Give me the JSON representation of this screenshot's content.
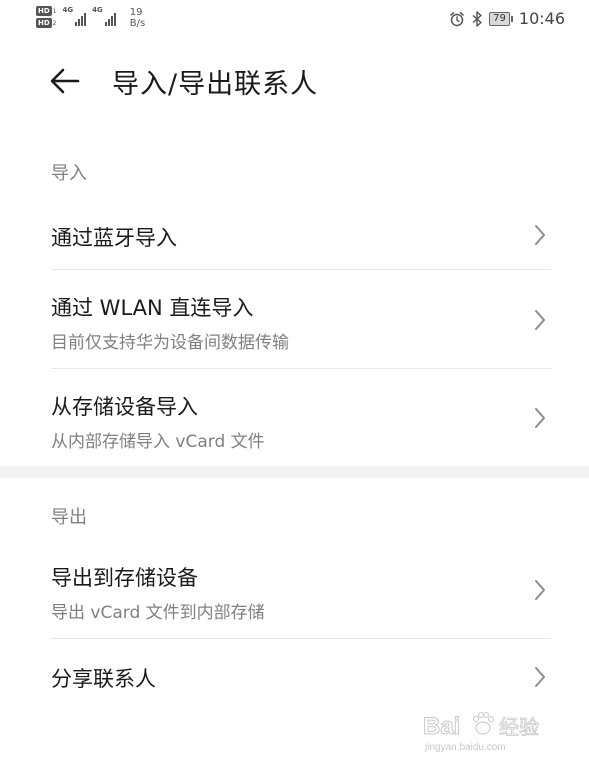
{
  "status_bar": {
    "hd1": "HD",
    "hd1_num": "1",
    "hd2": "HD",
    "hd2_num": "2",
    "signal1_tag": "4G",
    "signal2_tag": "4G",
    "net_speed_value": "19",
    "net_speed_unit": "B/s",
    "battery_level": "79",
    "time": "10:46",
    "icons": [
      "alarm-icon",
      "bluetooth-icon"
    ]
  },
  "header": {
    "title": "导入/导出联系人",
    "back_icon": "arrow-left-icon"
  },
  "import_section": {
    "title": "导入",
    "items": [
      {
        "title": "通过蓝牙导入",
        "subtitle": ""
      },
      {
        "title": "通过 WLAN 直连导入",
        "subtitle": "目前仅支持华为设备间数据传输"
      },
      {
        "title": "从存储设备导入",
        "subtitle": "从内部存储导入 vCard 文件"
      }
    ]
  },
  "export_section": {
    "title": "导出",
    "items": [
      {
        "title": "导出到存储设备",
        "subtitle": "导出 vCard 文件到内部存储"
      },
      {
        "title": "分享联系人",
        "subtitle": ""
      }
    ]
  },
  "watermark": {
    "brand": "Bai",
    "brand_suffix": "经验",
    "url": "jingyan.baidu.com"
  },
  "colors": {
    "primary_text": "#1a1a1a",
    "secondary_text": "#808080",
    "divider": "#e6e6e6",
    "section_gap": "#f2f2f2"
  }
}
